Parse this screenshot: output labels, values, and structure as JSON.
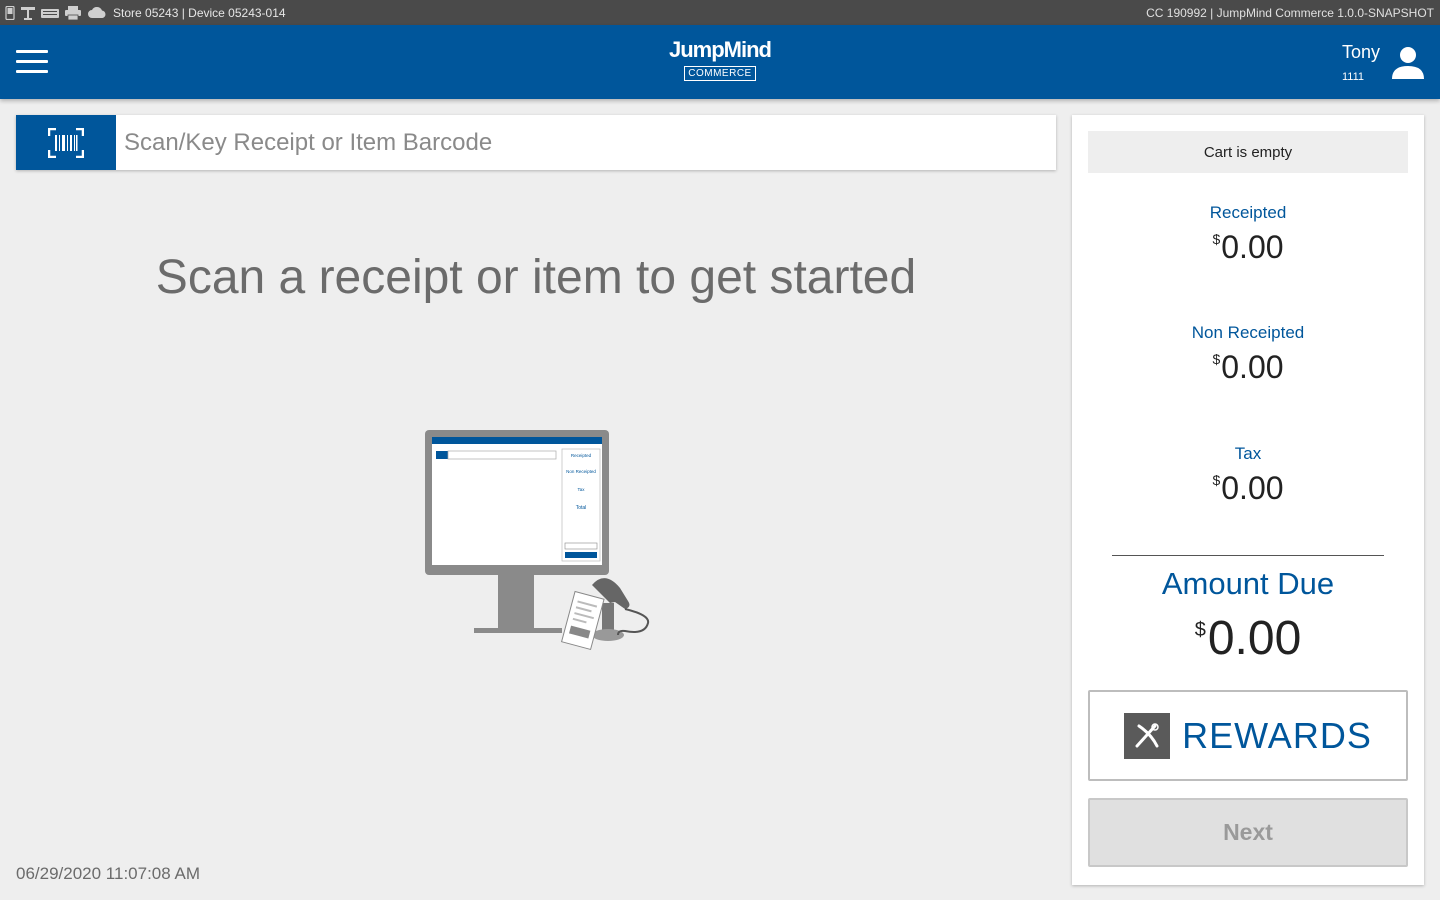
{
  "status_bar": {
    "left_text": "Store 05243 | Device 05243-014",
    "right_text": "CC 190992 | JumpMind Commerce 1.0.0-SNAPSHOT",
    "icons": [
      "phone-icon",
      "printer-stand-icon",
      "keyboard-icon",
      "printer-icon",
      "cloud-icon"
    ]
  },
  "header": {
    "logo_main": "JumpMind",
    "logo_sub": "COMMERCE",
    "user_name": "Tony",
    "user_id": "1111",
    "menu_icon": "hamburger-menu-icon",
    "user_icon": "person-icon",
    "color": "#00569b"
  },
  "scan": {
    "placeholder": "Scan/Key Receipt or Item Barcode",
    "value": "",
    "icon": "barcode-scan-icon"
  },
  "main": {
    "prompt": "Scan a receipt or item to get started",
    "datetime": "06/29/2020 11:07:08 AM",
    "illustration": {
      "labels": [
        "Receipted",
        "Non Receipted",
        "Tax",
        "Total"
      ]
    }
  },
  "totals": {
    "cart_status": "Cart is empty",
    "currency": "$",
    "receipted": {
      "label": "Receipted",
      "value": "0.00"
    },
    "non_receipted": {
      "label": "Non Receipted",
      "value": "0.00"
    },
    "tax": {
      "label": "Tax",
      "value": "0.00"
    },
    "amount_due": {
      "label": "Amount Due",
      "value": "0.00"
    }
  },
  "rewards": {
    "label": "REWARDS",
    "icon": "rewards-x-icon"
  },
  "actions": {
    "next_label": "Next",
    "next_enabled": false
  }
}
